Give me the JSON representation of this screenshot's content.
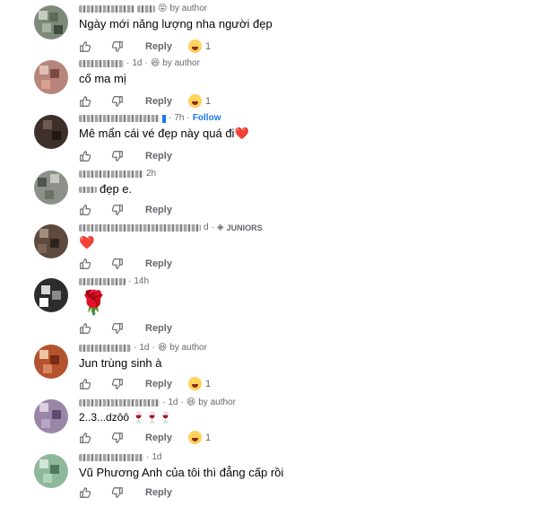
{
  "comments": [
    {
      "meta": {
        "time": "",
        "badge_emoji": "😝",
        "tag": "by author"
      },
      "text": "Ngày mới năng lượng nha người đẹp",
      "reply": "Reply",
      "reaction_count": "1"
    },
    {
      "meta": {
        "time": "1d",
        "badge_emoji": "😆",
        "tag": "by author"
      },
      "text": "cố ma mị",
      "reply": "Reply",
      "reaction_count": "1"
    },
    {
      "meta": {
        "time": "7h",
        "badge_emoji": "",
        "tag": "Follow"
      },
      "text": "Mê mẩn cái vé đẹp này quá đi",
      "text_emoji": "❤️",
      "reply": "Reply",
      "reaction_count": ""
    },
    {
      "meta": {
        "time": "2h",
        "badge_emoji": "",
        "tag": ""
      },
      "text": "đẹp e.",
      "reply": "Reply",
      "reaction_count": ""
    },
    {
      "meta": {
        "time": "d",
        "badge_emoji": "",
        "tag": "JUNIORS"
      },
      "text": "",
      "text_emoji": "❤️",
      "reply": "Reply",
      "reaction_count": ""
    },
    {
      "meta": {
        "time": "14h",
        "badge_emoji": "",
        "tag": ""
      },
      "text": "",
      "text_emoji": "🌹",
      "reply": "Reply",
      "reaction_count": ""
    },
    {
      "meta": {
        "time": "1d",
        "badge_emoji": "😆",
        "tag": "by author"
      },
      "text": "Jun trùng sinh à",
      "reply": "Reply",
      "reaction_count": "1"
    },
    {
      "meta": {
        "time": "1d",
        "badge_emoji": "😆",
        "tag": "by author"
      },
      "text": "2..3...dzôô 🍷🍷🍷",
      "reply": "Reply",
      "reaction_count": "1"
    },
    {
      "meta": {
        "time": "1d",
        "badge_emoji": "",
        "tag": ""
      },
      "text": "Vũ Phương Anh của tôi thì đẳng cấp rồi",
      "reply": "Reply",
      "reaction_count": ""
    }
  ],
  "icons": {
    "like": "thumbs-up-icon",
    "dislike": "thumbs-down-icon",
    "reaction": "laughing-face-icon",
    "junior": "diamond-icon"
  },
  "colors": {
    "follow": "#1877f2",
    "muted": "#65676b",
    "heart": "#e41e3f"
  }
}
